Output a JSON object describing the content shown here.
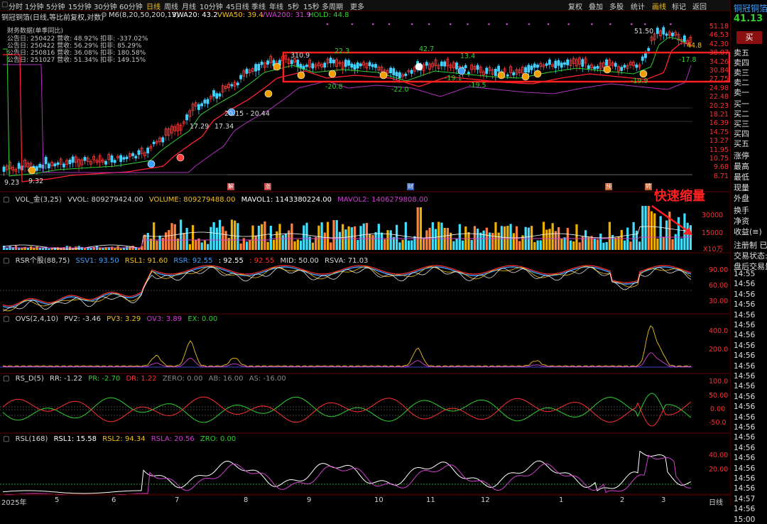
{
  "toolbar": {
    "periods": [
      "分时",
      "1分钟",
      "5分钟",
      "15分钟",
      "30分钟",
      "60分钟",
      "日线",
      "周线",
      "月线",
      "10分钟",
      "45日线",
      "季线",
      "年线",
      "5秒",
      "15秒",
      "多周期",
      "更多"
    ],
    "active_period": "日线",
    "right_buttons": [
      "复权",
      "叠加",
      "多股",
      "统计",
      "画线",
      "标记",
      "返回"
    ],
    "active_right": "画线"
  },
  "info": {
    "title": "铜冠铜箔(日线,等比前复权,对数)",
    "ma_label": "M6(8,20,50,200,13)",
    "vwa20": "VWA20: 43.2",
    "vwa50": "VWA50: 39.4",
    "vwa200": "VWA200: 31.9",
    "hold": "HOLD: 44.8"
  },
  "financials": {
    "header": "财务数据(单季同比)",
    "rows": [
      "公告日: 250422  营收: 48.92%  扣非: -337.02%",
      "公告日: 250422  营收: 56.29%  扣非: 85.29%",
      "公告日: 250816  营收: 36.08%  扣非: 180.58%",
      "公告日: 251027  营收: 51.34%  扣非: 149.15%"
    ]
  },
  "price_axis": [
    "51.18",
    "46.53",
    "42.30",
    "38.07",
    "34.26",
    "30.84",
    "27.75",
    "24.98",
    "22.48",
    "20.23",
    "18.21",
    "16.39",
    "14.75",
    "13.27",
    "11.95",
    "10.75",
    "9.68",
    "8.71"
  ],
  "price_annotations": [
    "310.9",
    "22.3",
    "42.7",
    "13.4",
    "-20.8",
    "-22.0",
    "-19.1",
    "-19.5",
    "17.29",
    "17.34",
    "20.15 - 20.44",
    "9.23",
    "9.32",
    "51.50",
    "44.8",
    "-17.8",
    "-19.9"
  ],
  "event_markers": [
    "解",
    "涨",
    "财",
    "预",
    "转"
  ],
  "volume": {
    "title": "VOL_金(3,25)",
    "vvol": "VVOL: 809279424.00",
    "volume": "VOLUME: 809279488.00",
    "mavol1": "MAVOL1: 1143380224.00",
    "mavol2": "MAVOL2: 1406279808.00",
    "annotation": "快速缩量",
    "axis": [
      "30000",
      "15000"
    ],
    "unit": "X10万"
  },
  "rsr": {
    "title": "RSR个股(88,75)",
    "ssv1": "SSV1: 93.50",
    "rsl1": "RSL1: 91.60",
    "rsr": "RSR: 92.55",
    "rsr2": ": 92.55",
    "rsr3": ": 92.55",
    "mid": "MID: 50.00",
    "rsva": "RSVA: 71.03",
    "axis": [
      "90.00",
      "60.00",
      "30.00"
    ]
  },
  "ovs": {
    "title": "OVS(2,4,10)",
    "pv2": "PV2: -3.46",
    "pv3": "PV3: 3.29",
    "ov3": "OV3: 3.89",
    "ex": "EX: 0.00",
    "axis": [
      "400.0",
      "200.0"
    ]
  },
  "rsd": {
    "title": "RS_D(5)",
    "rr": "RR: -1.22",
    "pr": "PR: -2.70",
    "dr": "DR: 1.22",
    "zero": "ZERO: 0.00",
    "ab": "AB: 16.00",
    "as": "AS: -16.00",
    "axis": [
      "100.0",
      "50.00",
      "0.00",
      "-50.0"
    ]
  },
  "rsl": {
    "title": "RSL(168)",
    "rsl1": "RSL1: 15.58",
    "rsl2": "RSL2: 94.34",
    "rsla": "RSLA: 20.56",
    "zro": "ZRO: 0.00",
    "axis": [
      "40.00",
      "20.00"
    ]
  },
  "xaxis": [
    "2025年",
    "5",
    "6",
    "7",
    "8",
    "9",
    "10",
    "11",
    "12",
    "1",
    "2",
    "3"
  ],
  "xaxis_label": "日线",
  "right_panel": {
    "name": "铜冠铜箔",
    "price": "41.13",
    "sell_button": "买",
    "order_book": [
      "卖五",
      "卖四",
      "卖三",
      "卖二",
      "卖一",
      "买一",
      "买二",
      "买三",
      "买四",
      "买五"
    ],
    "stats": [
      "涨停",
      "最高",
      "最低",
      "现量",
      "外盘"
    ],
    "stats2": [
      "换手",
      "净资",
      "收益(≡)"
    ],
    "status": [
      "注册制 已",
      "交易状态:",
      "盘后交易量"
    ],
    "times": [
      "14:55",
      "14:56",
      "14:56",
      "14:56",
      "14:56",
      "14:56",
      "14:56",
      "14:56",
      "14:56",
      "14:56",
      "14:56",
      "14:56",
      "14:56",
      "14:56",
      "14:56",
      "14:56",
      "14:56",
      "14:56",
      "14:56",
      "14:56",
      "14:56",
      "14:56",
      "14:57",
      "14:56",
      "15:00"
    ]
  },
  "colors": {
    "up": "#ff3b3b",
    "down": "#42c0ff",
    "vol_up": "#ff8040",
    "vol_yellow": "#f0b000",
    "vol_cyan": "#40e0ff",
    "accent": "#f0c020",
    "red_box": "#ff2020"
  }
}
